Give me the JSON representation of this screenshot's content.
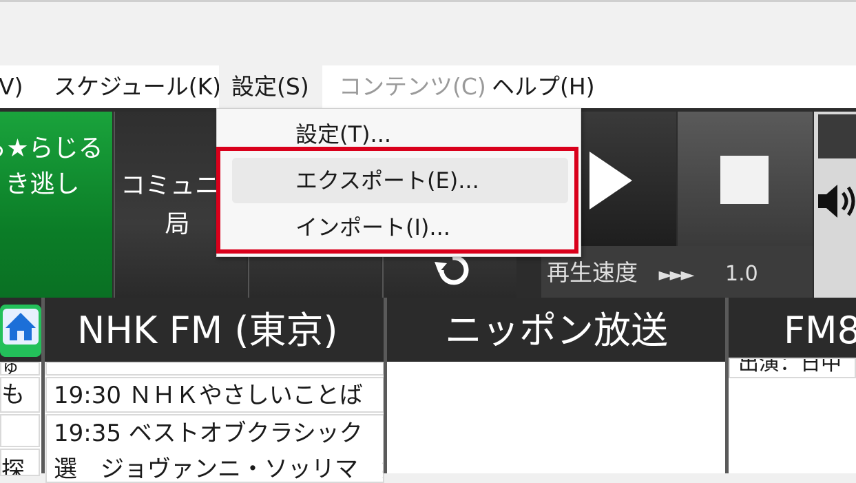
{
  "menubar": {
    "items": [
      {
        "label": "V)"
      },
      {
        "label": "スケジュール(K)"
      },
      {
        "label": "設定(S)"
      },
      {
        "label": "コンテンツ(C)"
      },
      {
        "label": "ヘルプ(H)"
      }
    ]
  },
  "dropdown": {
    "items": [
      {
        "label": "設定(T)..."
      },
      {
        "label": "エクスポート(E)..."
      },
      {
        "label": "インポート(I)..."
      }
    ]
  },
  "toolbar": {
    "green_line1": "ら★らじる",
    "green_line2": "き逃し",
    "community_line1": "コミュニテ",
    "community_line2": "局",
    "speed_label": "再生速度",
    "speed_arrows": "►►►",
    "speed_value": "1.0"
  },
  "stations": [
    {
      "name": "NHK FM (東京)"
    },
    {
      "name": "ニッポン放送"
    },
    {
      "name": "FM8"
    }
  ],
  "programs": {
    "left_fragments": [
      "ゅ",
      "も",
      "",
      "探"
    ],
    "nhkfm": [
      {
        "text": "19:30 ＮＨＫやさしいことば"
      },
      {
        "text": "19:35 ベストオブクラシック"
      },
      {
        "text": "選　ジョヴァンニ・ソッリマ　無"
      }
    ],
    "fm8_fragment": "出演：日中"
  },
  "colors": {
    "highlight": "#d9001b",
    "green_button": "#1aa33c",
    "toolbar_dark": "#2c2c2c"
  }
}
